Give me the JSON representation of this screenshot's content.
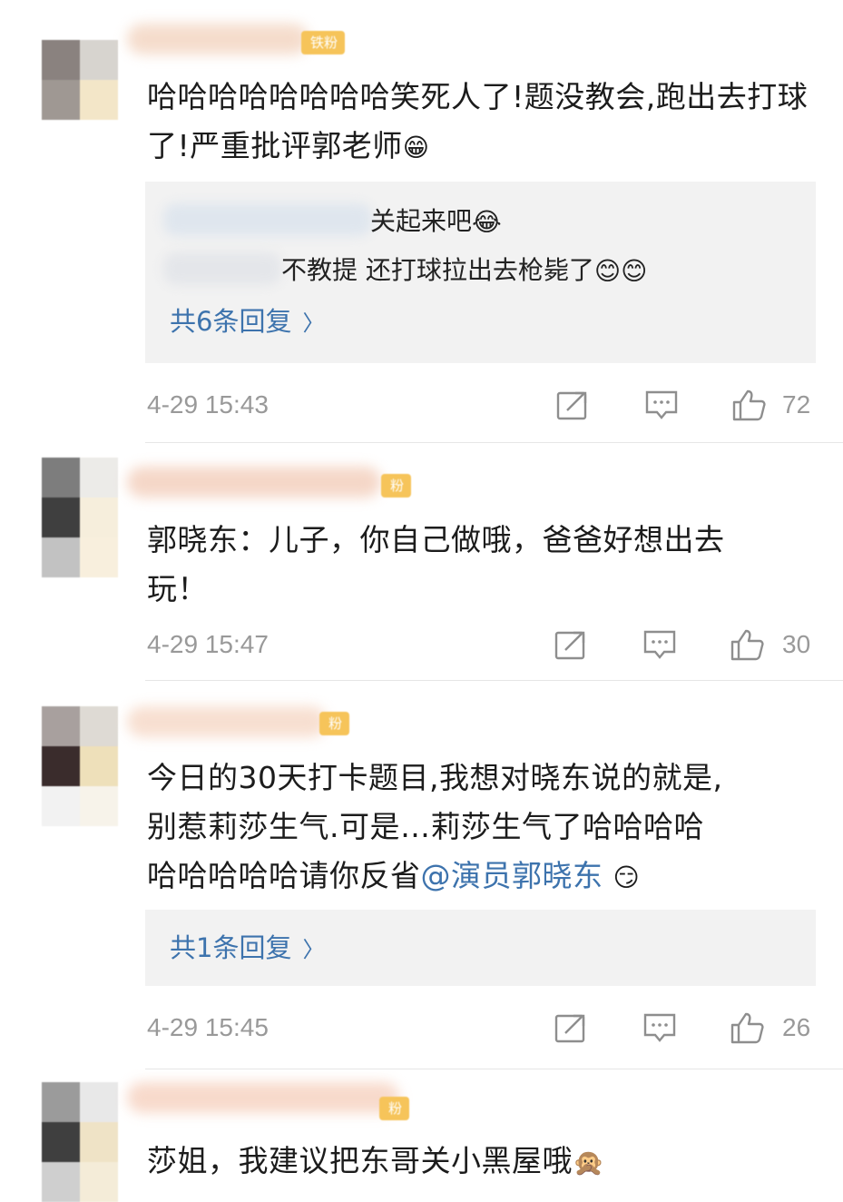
{
  "comments": [
    {
      "fan_badge": "铁粉",
      "text": "哈哈哈哈哈哈哈哈笑死人了!题没教会,跑出去打球了!严重批评郭老师",
      "emoji": "😁",
      "replies": [
        {
          "text": "关起来吧",
          "emoji": "😂"
        },
        {
          "text": "不教提 还打球拉出去枪毙了",
          "emoji": "😊😊"
        }
      ],
      "reply_count_label": "共6条回复",
      "timestamp": "4-29 15:43",
      "likes": "72"
    },
    {
      "fan_badge": "粉",
      "text_line1": "郭晓东：儿子，你自己做哦，爸爸好想出去",
      "text_line2": "玩！",
      "timestamp": "4-29 15:47",
      "likes": "30"
    },
    {
      "fan_badge": "粉",
      "text_line1": "今日的30天打卡题目,我想对晓东说的就是,",
      "text_line2": "别惹莉莎生气.可是…莉莎生气了哈哈哈哈",
      "text_line3": "哈哈哈哈哈请你反省",
      "mention": "@演员郭晓东",
      "emoji": "😏",
      "reply_count_label": "共1条回复",
      "timestamp": "4-29 15:45",
      "likes": "26"
    },
    {
      "fan_badge": "粉",
      "text": "莎姐，我建议把东哥关小黑屋哦",
      "emoji": "🙊"
    }
  ],
  "icons": {
    "share": "share-icon",
    "comment": "comment-icon",
    "like": "like-icon",
    "chevron": "chevron-right-icon"
  },
  "colors": {
    "link": "#3d73ad",
    "meta": "#999999",
    "reply_bg": "#f2f2f2",
    "badge": "#f6c45a"
  }
}
